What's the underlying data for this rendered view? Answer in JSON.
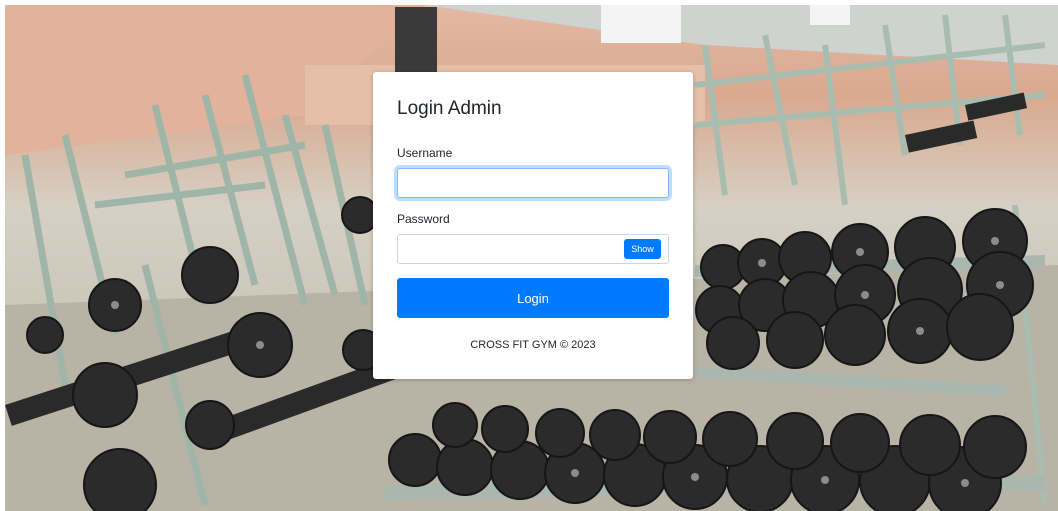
{
  "login": {
    "title": "Login Admin",
    "username_label": "Username",
    "username_value": "",
    "password_label": "Password",
    "password_value": "",
    "show_label": "Show",
    "login_label": "Login",
    "footer": "CROSS FIT GYM © 2023"
  },
  "colors": {
    "primary": "#007bff",
    "card_background": "#ffffff",
    "text": "#212529"
  }
}
